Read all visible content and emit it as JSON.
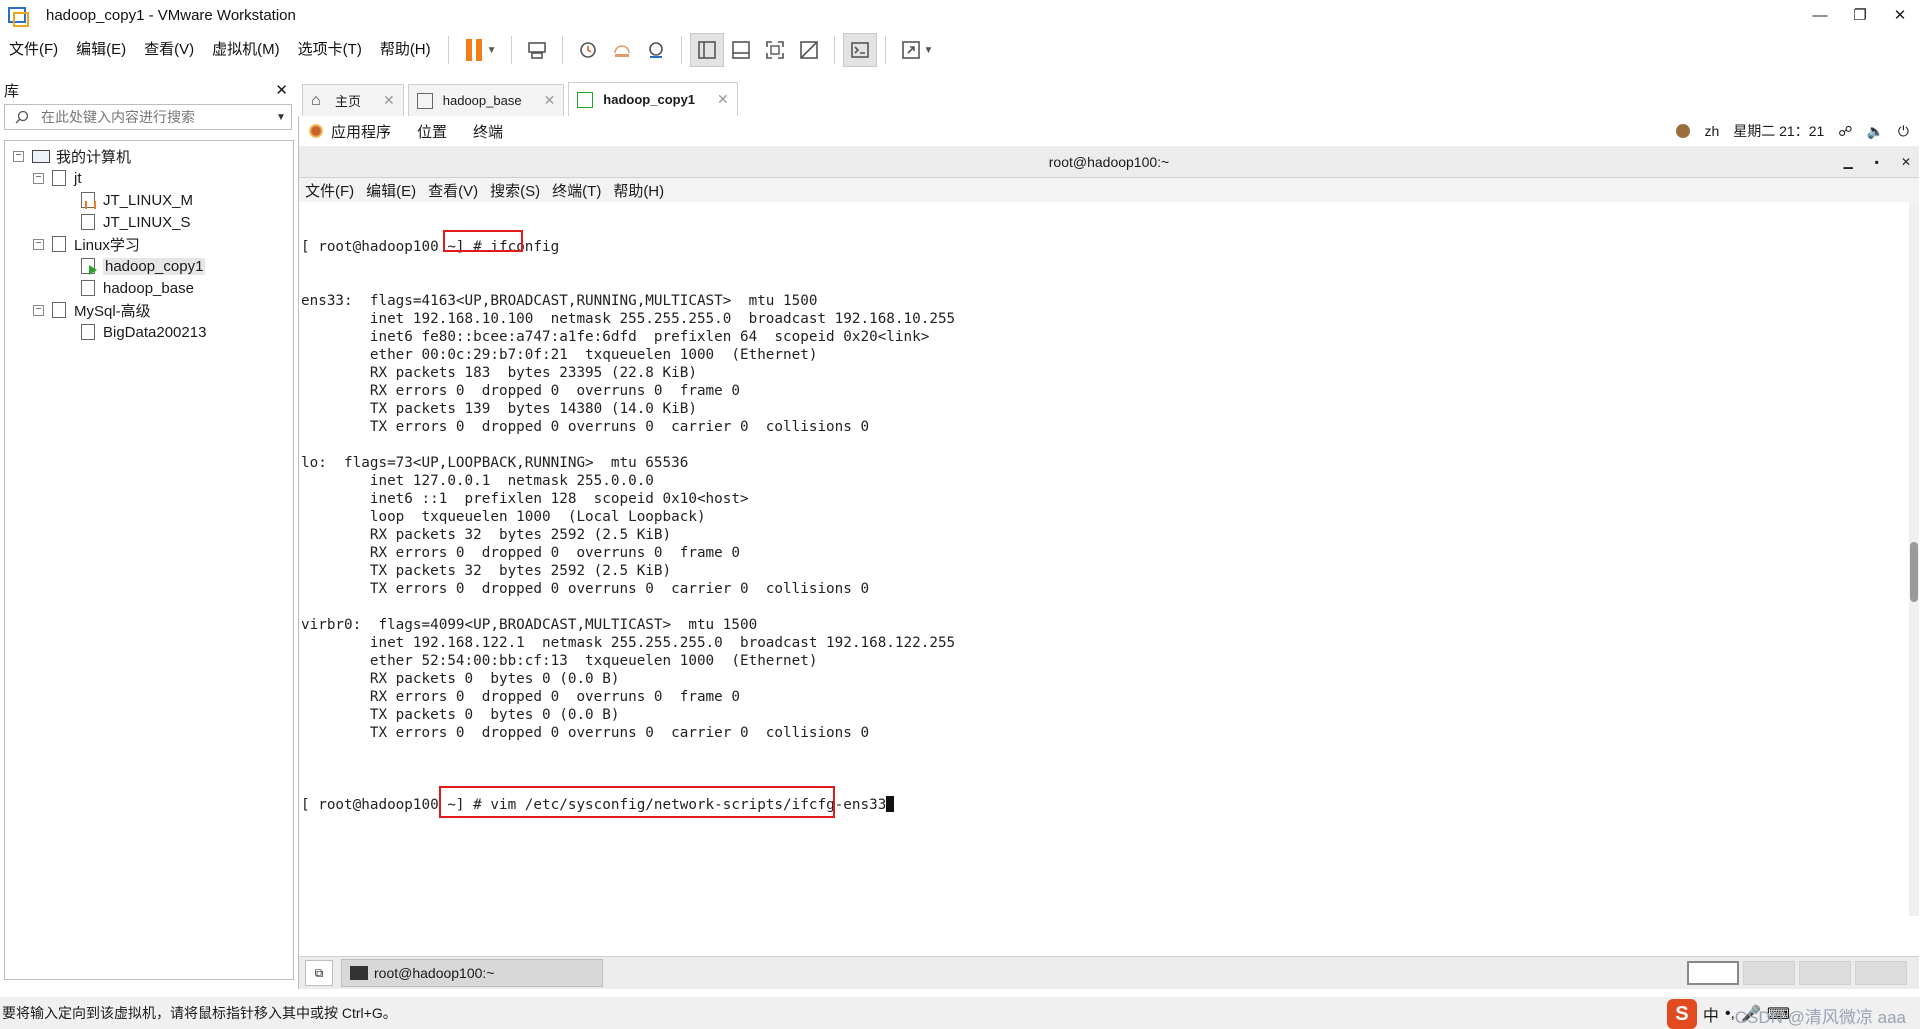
{
  "window": {
    "title": "hadoop_copy1 - VMware Workstation",
    "controls": [
      "—",
      "❐",
      "✕"
    ]
  },
  "menubar": [
    "文件(F)",
    "编辑(E)",
    "查看(V)",
    "虚拟机(M)",
    "选项卡(T)",
    "帮助(H)"
  ],
  "library": {
    "title": "库",
    "close": "✕",
    "search_placeholder": "在此处键入内容进行搜索",
    "tree": {
      "root": "我的计算机",
      "groups": [
        {
          "name": "jt",
          "items": [
            "JT_LINUX_M",
            "JT_LINUX_S"
          ]
        },
        {
          "name": "Linux学习",
          "items": [
            "hadoop_copy1",
            "hadoop_base"
          ]
        },
        {
          "name": "MySql-高级",
          "items": [
            "BigData200213"
          ]
        }
      ]
    }
  },
  "tabs": [
    {
      "label": "主页",
      "active": false
    },
    {
      "label": "hadoop_base",
      "active": false
    },
    {
      "label": "hadoop_copy1",
      "active": true
    }
  ],
  "guest_topbar": {
    "menus": [
      "应用程序",
      "位置",
      "终端"
    ],
    "lang": "zh",
    "clock": "星期二 21：21"
  },
  "terminal": {
    "title": "root@hadoop100:~",
    "menus": [
      "文件(F)",
      "编辑(E)",
      "查看(V)",
      "搜索(S)",
      "终端(T)",
      "帮助(H)"
    ],
    "prompt": "[ root@hadoop100 ~] # ",
    "command1": "ifconfig",
    "output": [
      "ens33:  flags=4163<UP,BROADCAST,RUNNING,MULTICAST>  mtu 1500",
      "        inet 192.168.10.100  netmask 255.255.255.0  broadcast 192.168.10.255",
      "        inet6 fe80::bcee:a747:a1fe:6dfd  prefixlen 64  scopeid 0x20<link>",
      "        ether 00:0c:29:b7:0f:21  txqueuelen 1000  (Ethernet)",
      "        RX packets 183  bytes 23395 (22.8 KiB)",
      "        RX errors 0  dropped 0  overruns 0  frame 0",
      "        TX packets 139  bytes 14380 (14.0 KiB)",
      "        TX errors 0  dropped 0 overruns 0  carrier 0  collisions 0",
      "",
      "lo:  flags=73<UP,LOOPBACK,RUNNING>  mtu 65536",
      "        inet 127.0.0.1  netmask 255.0.0.0",
      "        inet6 ::1  prefixlen 128  scopeid 0x10<host>",
      "        loop  txqueuelen 1000  (Local Loopback)",
      "        RX packets 32  bytes 2592 (2.5 KiB)",
      "        RX errors 0  dropped 0  overruns 0  frame 0",
      "        TX packets 32  bytes 2592 (2.5 KiB)",
      "        TX errors 0  dropped 0 overruns 0  carrier 0  collisions 0",
      "",
      "virbr0:  flags=4099<UP,BROADCAST,MULTICAST>  mtu 1500",
      "        inet 192.168.122.1  netmask 255.255.255.0  broadcast 192.168.122.255",
      "        ether 52:54:00:bb:cf:13  txqueuelen 1000  (Ethernet)",
      "        RX packets 0  bytes 0 (0.0 B)",
      "        RX errors 0  dropped 0  overruns 0  frame 0",
      "        TX packets 0  bytes 0 (0.0 B)",
      "        TX errors 0  dropped 0 overruns 0  carrier 0  collisions 0",
      ""
    ],
    "command2": "vim /etc/sysconfig/network-scripts/ifcfg-ens33"
  },
  "guest_taskbar": {
    "task_label": "root@hadoop100:~"
  },
  "statusbar": {
    "text": "要将输入定向到该虚拟机，请将鼠标指针移入其中或按 Ctrl+G。",
    "ime": "中",
    "watermark": "CSDN @清风微凉 aaa",
    "sogou": "S"
  },
  "colors": {
    "highlight_box": "#e11b1b",
    "pause_accent": "#f07c1a"
  }
}
